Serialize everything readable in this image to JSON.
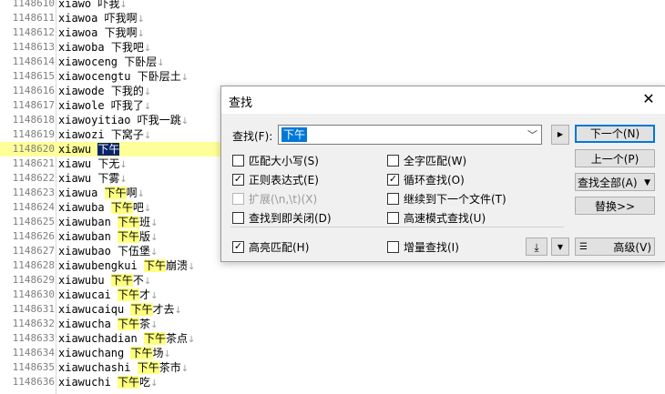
{
  "editor": {
    "lines": [
      {
        "n": "1148610",
        "py": "xiawo",
        "sep": " ",
        "pre": "",
        "match": "",
        "post": "吓我",
        "eol": "↓"
      },
      {
        "n": "1148611",
        "py": "xiawoa",
        "sep": " ",
        "pre": "",
        "match": "",
        "post": "吓我啊",
        "eol": "↓"
      },
      {
        "n": "1148612",
        "py": "xiawoa",
        "sep": " ",
        "pre": "",
        "match": "",
        "post": "下我啊",
        "eol": "↓"
      },
      {
        "n": "1148613",
        "py": "xiawoba",
        "sep": " ",
        "pre": "",
        "match": "",
        "post": "下我吧",
        "eol": "↓"
      },
      {
        "n": "1148614",
        "py": "xiawoceng",
        "sep": " ",
        "pre": "",
        "match": "",
        "post": "下卧层",
        "eol": "↓"
      },
      {
        "n": "1148615",
        "py": "xiawocengtu",
        "sep": " ",
        "pre": "",
        "match": "",
        "post": "下卧层土",
        "eol": "↓"
      },
      {
        "n": "1148616",
        "py": "xiawode",
        "sep": " ",
        "pre": "",
        "match": "",
        "post": "下我的",
        "eol": "↓"
      },
      {
        "n": "1148617",
        "py": "xiawole",
        "sep": " ",
        "pre": "",
        "match": "",
        "post": "吓我了",
        "eol": "↓"
      },
      {
        "n": "1148618",
        "py": "xiawoyitiao",
        "sep": " ",
        "pre": "",
        "match": "",
        "post": "吓我一跳",
        "eol": "↓"
      },
      {
        "n": "1148619",
        "py": "xiawozi",
        "sep": " ",
        "pre": "",
        "match": "",
        "post": "下窝子",
        "eol": "↓"
      },
      {
        "n": "1148620",
        "py": "xiawu",
        "sep": " ",
        "pre": "",
        "match": "下午",
        "post": "",
        "eol": "",
        "current": true,
        "selected": true
      },
      {
        "n": "1148621",
        "py": "xiawu",
        "sep": " ",
        "pre": "",
        "match": "",
        "post": "下无",
        "eol": "↓"
      },
      {
        "n": "1148622",
        "py": "xiawu",
        "sep": " ",
        "pre": "",
        "match": "",
        "post": "下雾",
        "eol": "↓"
      },
      {
        "n": "1148623",
        "py": "xiawua",
        "sep": " ",
        "pre": "",
        "match": "下午",
        "post": "啊",
        "eol": "↓"
      },
      {
        "n": "1148624",
        "py": "xiawuba",
        "sep": " ",
        "pre": "",
        "match": "下午",
        "post": "吧",
        "eol": "↓"
      },
      {
        "n": "1148625",
        "py": "xiawuban",
        "sep": " ",
        "pre": "",
        "match": "下午",
        "post": "班",
        "eol": "↓"
      },
      {
        "n": "1148626",
        "py": "xiawuban",
        "sep": " ",
        "pre": "",
        "match": "下午",
        "post": "版",
        "eol": "↓"
      },
      {
        "n": "1148627",
        "py": "xiawubao",
        "sep": " ",
        "pre": "",
        "match": "",
        "post": "下伍堡",
        "eol": "↓"
      },
      {
        "n": "1148628",
        "py": "xiawubengkui",
        "sep": " ",
        "pre": "",
        "match": "下午",
        "post": "崩溃",
        "eol": "↓"
      },
      {
        "n": "1148629",
        "py": "xiawubu",
        "sep": " ",
        "pre": "",
        "match": "下午",
        "post": "不",
        "eol": "↓"
      },
      {
        "n": "1148630",
        "py": "xiawucai",
        "sep": " ",
        "pre": "",
        "match": "下午",
        "post": "才",
        "eol": "↓"
      },
      {
        "n": "1148631",
        "py": "xiawucaiqu",
        "sep": " ",
        "pre": "",
        "match": "下午",
        "post": "才去",
        "eol": "↓"
      },
      {
        "n": "1148632",
        "py": "xiawucha",
        "sep": " ",
        "pre": "",
        "match": "下午",
        "post": "茶",
        "eol": "↓"
      },
      {
        "n": "1148633",
        "py": "xiawuchadian",
        "sep": " ",
        "pre": "",
        "match": "下午",
        "post": "茶点",
        "eol": "↓"
      },
      {
        "n": "1148634",
        "py": "xiawuchang",
        "sep": " ",
        "pre": "",
        "match": "下午",
        "post": "场",
        "eol": "↓"
      },
      {
        "n": "1148635",
        "py": "xiawuchashi",
        "sep": " ",
        "pre": "",
        "match": "下午",
        "post": "茶市",
        "eol": "↓"
      },
      {
        "n": "1148636",
        "py": "xiawuchi",
        "sep": " ",
        "pre": "",
        "match": "下午",
        "post": "吃",
        "eol": "↓"
      }
    ]
  },
  "dialog": {
    "title": "查找",
    "close_icon": "close-icon",
    "find_label": "查找(F):",
    "find_value": "下午",
    "options": {
      "match_case": {
        "label": "匹配大小写(S)",
        "checked": false
      },
      "regex": {
        "label": "正则表达式(E)",
        "checked": true
      },
      "extended": {
        "label": "扩展(\\n,\\t)(X)",
        "checked": false,
        "disabled": true
      },
      "close_on_find": {
        "label": "查找到即关闭(D)",
        "checked": false
      },
      "whole_word": {
        "label": "全字匹配(W)",
        "checked": false
      },
      "wrap": {
        "label": "循环查找(O)",
        "checked": true
      },
      "next_file": {
        "label": "继续到下一个文件(T)",
        "checked": false
      },
      "fast_mode": {
        "label": "高速模式查找(U)",
        "checked": false
      },
      "highlight": {
        "label": "高亮匹配(H)",
        "checked": true
      },
      "incremental": {
        "label": "增量查找(I)",
        "checked": false
      }
    },
    "buttons": {
      "next": "下一个(N)",
      "prev": "上一个(P)",
      "find_all": "查找全部(A)",
      "replace": "替换>>",
      "advanced": "高级(V)"
    }
  }
}
